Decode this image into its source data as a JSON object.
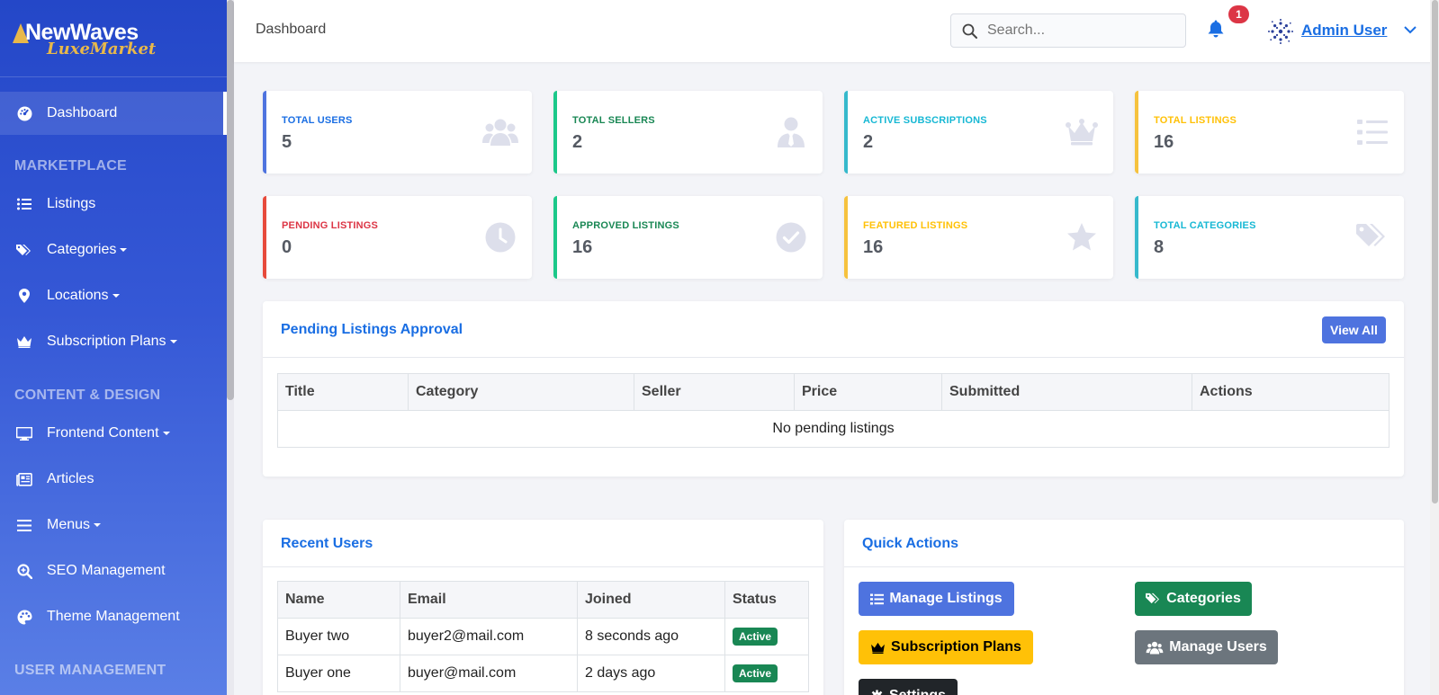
{
  "brand": {
    "line1": "NewWaves",
    "line2": "LuxeMarket"
  },
  "sidebar": {
    "dashboard": "Dashboard",
    "sections": {
      "marketplace": "MARKETPLACE",
      "content": "CONTENT & DESIGN",
      "users": "USER MANAGEMENT"
    },
    "items": {
      "listings": "Listings",
      "categories": "Categories",
      "locations": "Locations",
      "subscription_plans": "Subscription Plans",
      "frontend_content": "Frontend Content",
      "articles": "Articles",
      "menus": "Menus",
      "seo": "SEO Management",
      "theme": "Theme Management"
    }
  },
  "topbar": {
    "breadcrumb": "Dashboard",
    "search_placeholder": "Search...",
    "notification_count": "1",
    "user_name": "Admin User"
  },
  "stats": [
    {
      "label": "TOTAL USERS",
      "value": "5",
      "color": "#4e73df",
      "icon": "users-icon"
    },
    {
      "label": "TOTAL SELLERS",
      "value": "2",
      "color": "#1cc88a",
      "icon": "user-tie-icon"
    },
    {
      "label": "ACTIVE SUBSCRIPTIONS",
      "value": "2",
      "color": "#36b9cc",
      "icon": "crown-icon"
    },
    {
      "label": "TOTAL LISTINGS",
      "value": "16",
      "color": "#f6c23e",
      "icon": "list-icon"
    },
    {
      "label": "PENDING LISTINGS",
      "value": "0",
      "color": "#e74a3b",
      "icon": "clock-icon"
    },
    {
      "label": "APPROVED LISTINGS",
      "value": "16",
      "color": "#1cc88a",
      "icon": "check-circle-icon"
    },
    {
      "label": "FEATURED LISTINGS",
      "value": "16",
      "color": "#f6c23e",
      "icon": "star-icon"
    },
    {
      "label": "TOTAL CATEGORIES",
      "value": "8",
      "color": "#36b9cc",
      "icon": "tags-icon"
    }
  ],
  "pending": {
    "title": "Pending Listings Approval",
    "view_all": "View All",
    "columns": [
      "Title",
      "Category",
      "Seller",
      "Price",
      "Submitted",
      "Actions"
    ],
    "empty": "No pending listings"
  },
  "recent_users": {
    "title": "Recent Users",
    "columns": [
      "Name",
      "Email",
      "Joined",
      "Status"
    ],
    "rows": [
      {
        "name": "Buyer two",
        "email": "buyer2@mail.com",
        "joined": "8 seconds ago",
        "status": "Active"
      },
      {
        "name": "Buyer one",
        "email": "buyer@mail.com",
        "joined": "2 days ago",
        "status": "Active"
      }
    ]
  },
  "quick_actions": {
    "title": "Quick Actions",
    "manage_listings": "Manage Listings",
    "categories": "Categories",
    "subscription_plans": "Subscription Plans",
    "manage_users": "Manage Users",
    "settings": "Settings"
  },
  "colors": {
    "accent": "#1a6ee3",
    "primary_btn": "#4e73df",
    "success": "#198754",
    "warning": "#ffc107",
    "secondary": "#6c757d",
    "dark": "#212529"
  }
}
